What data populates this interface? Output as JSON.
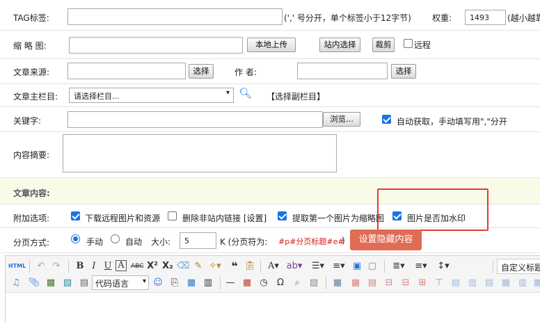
{
  "tag": {
    "label": "TAG标签:",
    "hint": "(',' 号分开，单个标签小于12字节)",
    "weight_label": "权重:",
    "weight_value": "1493",
    "weight_hint": "(越小越靠"
  },
  "thumb": {
    "label": "缩 略 图:",
    "upload_btn": "本地上传",
    "site_btn": "站内选择",
    "crop_btn": "裁剪",
    "remote_label": "远程"
  },
  "source": {
    "label": "文章来源:",
    "select_btn": "选择",
    "author_label": "作  者:",
    "author_btn": "选择"
  },
  "column": {
    "label": "文章主栏目:",
    "placeholder": "请选择栏目...",
    "sub_link": "【选择副栏目】"
  },
  "keywords": {
    "label": "关键字:",
    "browse_btn": "浏览...",
    "auto_label": "自动获取，手动填写用\",\"分开"
  },
  "summary": {
    "label": "内容摘要:"
  },
  "content_section": {
    "title": "文章内容:"
  },
  "options": {
    "label": "附加选项:",
    "opt1": "下载远程图片和资源",
    "opt2": "删除非站内链接 [设置]",
    "opt3": "提取第一个图片为缩略图",
    "opt4": "图片是否加水印"
  },
  "paging": {
    "label": "分页方式:",
    "manual": "手动",
    "auto": "自动",
    "size_label": "大小:",
    "size_value": "5",
    "k_text": "K (分页符为:",
    "marker": "#p#分页标题#e#",
    "close_paren": ")",
    "hidden_btn": "设置隐藏内容"
  },
  "editor": {
    "code_lang": "代码语言",
    "custom_title": "自定义标题"
  },
  "colors": {
    "accent": "#1a73e8",
    "highlight_box": "#e53935",
    "hidden_btn_bg": "#e06c55",
    "marker_red": "#d11a1a"
  }
}
